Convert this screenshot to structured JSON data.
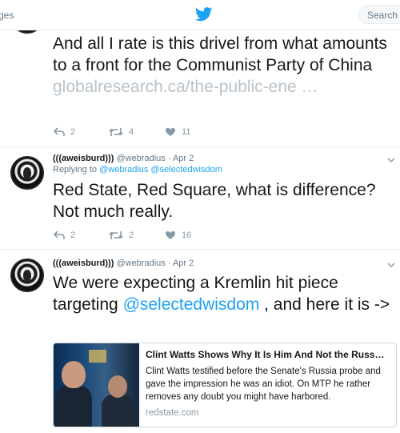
{
  "topbar": {
    "nav_fragment": "ges",
    "search_placeholder": "Search T"
  },
  "tweets": [
    {
      "text": "And all I rate is this drivel from what amounts to a front for the Communist Party of China ",
      "link": "globalresearch.ca/the-public-ene …",
      "replies": "2",
      "retweets": "4",
      "likes": "11"
    },
    {
      "display_name": "(((aweisburd)))",
      "handle": "@webradius",
      "time": "· Apr 2",
      "replying_label": "Replying to",
      "replying_to": "@webradius @selectedwisdom",
      "text": "Red State, Red Square, what is difference? Not much really.",
      "replies": "2",
      "retweets": "2",
      "likes": "16"
    },
    {
      "display_name": "(((aweisburd)))",
      "handle": "@webradius",
      "time": "· Apr 2",
      "text_before": "We were expecting a Kremlin hit piece targeting ",
      "mention": "@selectedwisdom",
      "text_after": " , and here it is ->",
      "card": {
        "title": "Clint Watts Shows Why It Is Him And Not the Russ…",
        "description": "Clint Watts testified before the Senate's Russia probe and gave the impression he was an idiot. On MTP he rather removes any doubt you might have harbored.",
        "domain": "redstate.com"
      }
    }
  ],
  "colors": {
    "accent": "#1da1f2",
    "muted": "#8899a6",
    "border": "#e6ecf0"
  },
  "icons": [
    "twitter-bird-icon",
    "reply-icon",
    "retweet-icon",
    "heart-icon",
    "chevron-down-icon"
  ]
}
